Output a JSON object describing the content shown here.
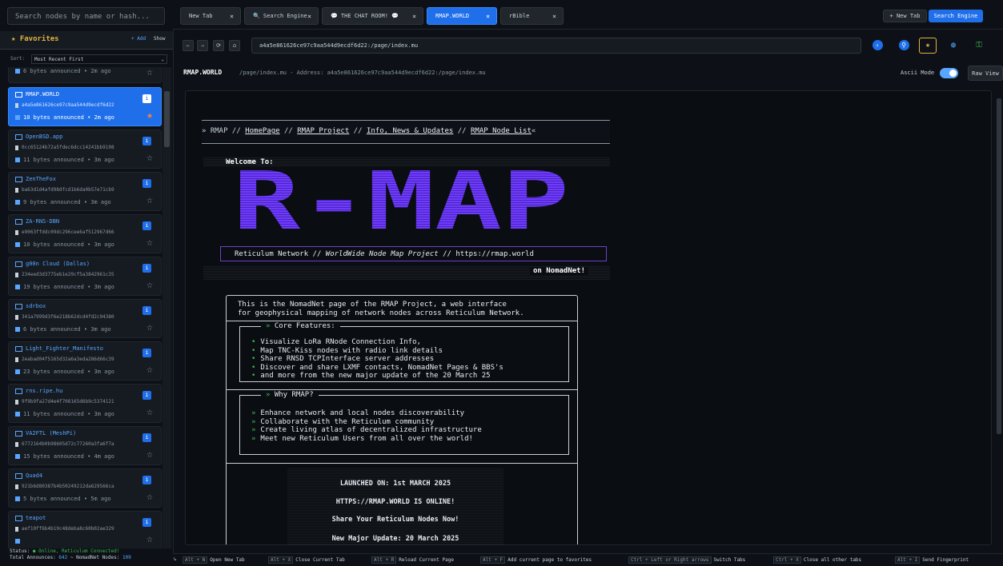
{
  "sidebar": {
    "search_placeholder": "Search nodes by name or hash...",
    "favorites_title": "★ Favorites",
    "add_label": "+ Add",
    "show_label": "Show",
    "sort_label": "Sort:",
    "sort_value": "Most Recent First",
    "top_partial": "6 bytes announced • 2m ago",
    "nodes": [
      {
        "name": "RMAP.WORLD",
        "hash": "a4a5e861626ce97c9aa544d9ecdf6d22",
        "announce": "10 bytes announced • 2m ago",
        "active": true
      },
      {
        "name": "OpenBSD.app",
        "hash": "0cc65124b72a5fdec6dcc14241bb9108",
        "announce": "11 bytes announced • 3m ago"
      },
      {
        "name": "ZenTheFox",
        "hash": "ba63d1d4afd98dfcd1b6da0b57e71cb9",
        "announce": "9 bytes announced • 3m ago"
      },
      {
        "name": "ZA-RNS-DBN",
        "hash": "e9063ffddc09dc296cee6af512967d66",
        "announce": "10 bytes announced • 3m ago"
      },
      {
        "name": "g00n Cloud (Dallas)",
        "hash": "234eed3d3775eb1e29cf5a3842961c35",
        "announce": "19 bytes announced • 3m ago"
      },
      {
        "name": "sdrbox",
        "hash": "341a7999d3f6e218b62dcd4fd2c94380",
        "announce": "6 bytes announced • 3m ago"
      },
      {
        "name": "Light_Fighter_Manifesto",
        "hash": "2eabad04f5165d32a6a3eda286d66c39",
        "announce": "23 bytes announced • 3m ago"
      },
      {
        "name": "rns.ripe.hu",
        "hash": "9f9b9fa27d4e4f708165d6b9c5374121",
        "announce": "11 bytes announced • 3m ago"
      },
      {
        "name": "VA2FTL (MeshPi)",
        "hash": "6772164b0b98605d72c77260a3fa6f7a",
        "announce": "15 bytes announced • 4m ago"
      },
      {
        "name": "Quad4",
        "hash": "921b6d80387b4b50249212da629566ca",
        "announce": "5 bytes announced • 5m ago"
      },
      {
        "name": "teapot",
        "hash": "aef10ff6b4b19c48deba8c60b02ae329",
        "announce": ""
      }
    ],
    "status_prefix": "Status:",
    "status_value": "● Online, Reticulum Connected!",
    "total_prefix": "Total Announces:",
    "total_announces": "642",
    "nomadnet_prefix": "~ NomadNet Nodes:",
    "nomadnet_nodes": "109"
  },
  "tabs": [
    {
      "label": "New Tab"
    },
    {
      "label": "🔍 Search Engine"
    },
    {
      "label": "💬 THE CHAT ROOM! 💬"
    },
    {
      "label": "RMAP.WORLD",
      "active": true
    },
    {
      "label": "rBible"
    }
  ],
  "tab_close": "×",
  "new_tab_button": "+ New Tab",
  "search_engine_button": "Search Engine",
  "address": {
    "back": "←",
    "forward": "→",
    "reload": "⟳",
    "home": "⌂",
    "url": "a4a5e861626ce97c9aa544d9ecdf6d22:/page/index.mu"
  },
  "breadcrumb": {
    "site": "RMAP.WORLD",
    "path": "/page/index.mu - Address: a4a5e861626ce97c9aa544d9ecdf6d22:/page/index.mu",
    "ascii_mode": "Ascii Mode",
    "raw_view": "Raw View"
  },
  "page": {
    "nav_prefix": "» RMAP // ",
    "nav_links": [
      "HomePage",
      "RMAP Project",
      "Info, News & Updates",
      "RMAP Node List"
    ],
    "nav_seps": [
      " // ",
      " // ",
      " // "
    ],
    "nav_suffix": "«",
    "welcome": "Welcome To:",
    "logo_text": "R-MAP",
    "rw_line_a": "Reticulum Network  //  ",
    "rw_line_b": "WorldWide Node Map Project",
    "rw_line_c": "  //  https://rmap.world",
    "nomadnet": "on NomadNet!",
    "intro": "This is the NomadNet page of the RMAP Project, a web interface\nfor geophysical mapping of network nodes across Reticulum Network.",
    "core_title": "Core Features:",
    "core_items": [
      "Visualize LoRa RNode Connection Info,",
      "Map TNC-Kiss nodes with radio link details",
      "Share RNSD TCPInterface server addresses",
      "Discover and share LXMF contacts, NomadNet Pages & BBS's",
      "and more from the new major update of the 20 March 25"
    ],
    "why_title": "Why RMAP?",
    "why_items": [
      "Enhance network and local nodes discoverability",
      "Collaborate with the Reticulum community",
      "Create living atlas of decentralized infrastructure",
      "Meet new Reticulum Users from all over the world!"
    ],
    "launch_lines": [
      "LAUNCHED ON: 1st MARCH 2025",
      "HTTPS://RMAP.WORLD IS ONLINE!",
      "Share Your Reticulum Nodes Now!",
      "New Major Update: 20 March 2025"
    ]
  },
  "footer": {
    "items": [
      {
        "key": "Alt + N",
        "label": "Open New Tab"
      },
      {
        "key": "Alt + X",
        "label": "Close Current Tab"
      },
      {
        "key": "Alt + R",
        "label": "Reload Current Page"
      },
      {
        "key": "Alt + F",
        "label": "Add current page to favorites"
      },
      {
        "key": "Ctrl + Left or Right arrows",
        "label": "Switch Tabs"
      },
      {
        "key": "Ctrl + X",
        "label": "Close all other tabs"
      },
      {
        "key": "Alt + I",
        "label": "Send Fingerprint"
      }
    ]
  },
  "colors": {
    "accent": "#1f6feb",
    "logo": "#6e40c9",
    "star": "#e3b341",
    "ok": "#3fb950"
  },
  "icons": [
    "search-icon",
    "star-icon",
    "terminal-icon",
    "document-icon",
    "signal-icon",
    "info-icon",
    "globe-icon",
    "lock-icon"
  ]
}
